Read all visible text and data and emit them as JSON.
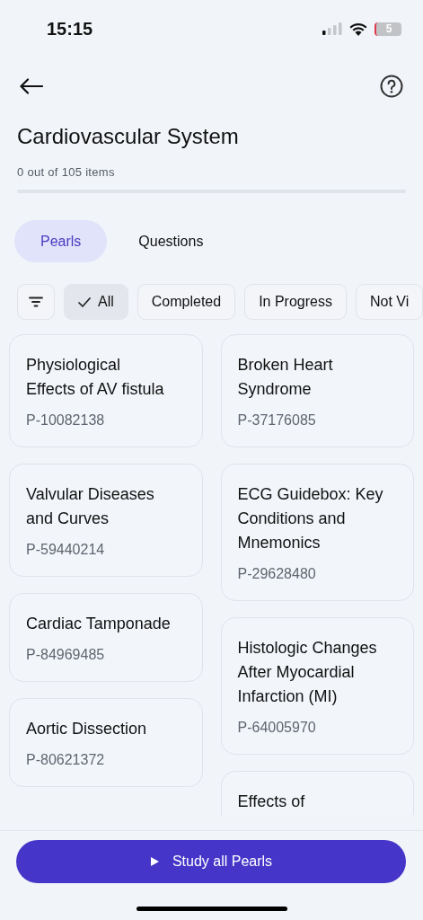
{
  "status_bar": {
    "time": "15:15",
    "battery": "5"
  },
  "header": {
    "title": "Cardiovascular System",
    "progress_text": "0 out of 105 items",
    "progress": {
      "level": 0
    }
  },
  "tabs": [
    {
      "label": "Pearls",
      "selected": true
    },
    {
      "label": "Questions",
      "selected": false
    }
  ],
  "filters": [
    {
      "label": "All",
      "selected": true
    },
    {
      "label": "Completed",
      "selected": false
    },
    {
      "label": "In Progress",
      "selected": false
    },
    {
      "label": "Not Vi",
      "selected": false
    }
  ],
  "columns": [
    [
      {
        "title": "Physiological Effects of AV fistula",
        "code": "P-10082138"
      },
      {
        "title": "Valvular Diseases and Curves",
        "code": "P-59440214"
      },
      {
        "title": "Cardiac Tamponade",
        "code": "P-84969485"
      },
      {
        "title": "Aortic Dissection",
        "code": "P-80621372"
      }
    ],
    [
      {
        "title": "Broken Heart Syndrome",
        "code": "P-37176085"
      },
      {
        "title": "ECG Guidebox: Key Conditions and Mnemonics",
        "code": "P-29628480"
      },
      {
        "title": "Histologic Changes After Myocardial Infarction (MI)",
        "code": "P-64005970"
      },
      {
        "title": "Effects of"
      }
    ]
  ],
  "study_button": {
    "label": "Study all Pearls"
  }
}
